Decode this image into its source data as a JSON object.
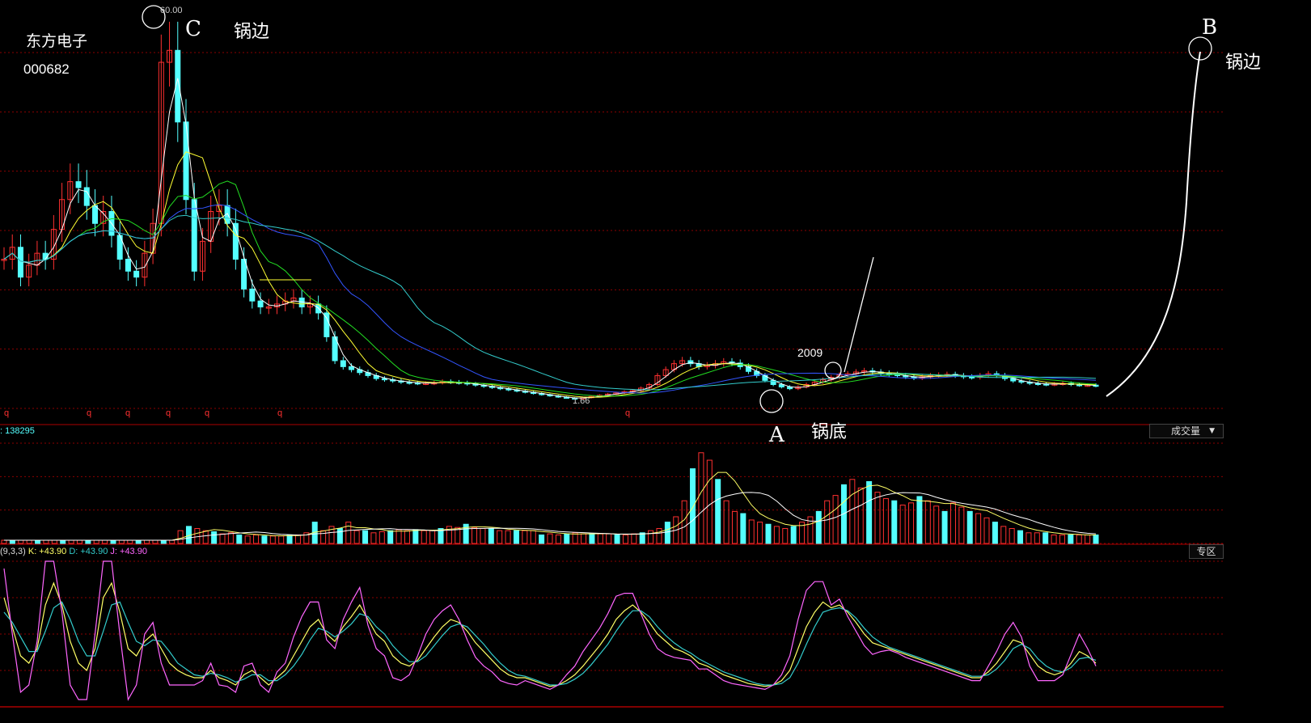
{
  "stock": {
    "name": "东方电子",
    "code": "000682"
  },
  "annotations": {
    "c_letter": "C",
    "c_label": "锅边",
    "b_letter": "B",
    "b_label": "锅边",
    "a_letter": "A",
    "a_label": "锅底",
    "year": "2009",
    "high_price": "60.00",
    "low_price": "1.66"
  },
  "volume_panel": {
    "value_label": ": 138295",
    "dropdown": "成交量"
  },
  "kdj_panel": {
    "params": "(9,3,3)",
    "k_label": "K: +43.90",
    "d_label": "D: +43.90",
    "j_label": "J: +43.90",
    "zone_button": "专区"
  },
  "colors": {
    "up": "#ff3030",
    "down": "#54ffff",
    "grid": "#8b0000",
    "k_line": "#ffff66",
    "d_line": "#33cccc",
    "j_line": "#ff66ff"
  },
  "chart_data": [
    {
      "type": "line",
      "name": "price-panel",
      "x": [
        0,
        10,
        20,
        30,
        40,
        50,
        60,
        70,
        80,
        90,
        100,
        110,
        120,
        130,
        140,
        150,
        160,
        170,
        180,
        190,
        200,
        210,
        220,
        230,
        240,
        250,
        260,
        270,
        280,
        290,
        300,
        310,
        320,
        330,
        340,
        350,
        360,
        370,
        380,
        390,
        400,
        410,
        420,
        430,
        440,
        450,
        460,
        470,
        480,
        490,
        500,
        510,
        520,
        530,
        540,
        550,
        560,
        570,
        580,
        590,
        600,
        610,
        620,
        630,
        640,
        650,
        660,
        670,
        680,
        690,
        700,
        710,
        720,
        730,
        740,
        750,
        760,
        770,
        780,
        790,
        800,
        810,
        820,
        830,
        840,
        850,
        860,
        870,
        880,
        890,
        900,
        910,
        920,
        930,
        940,
        950,
        960,
        970,
        980,
        990,
        1000,
        1010,
        1020,
        1030,
        1040,
        1050,
        1060,
        1070,
        1080,
        1090,
        1100,
        1110,
        1120,
        1130,
        1140,
        1150,
        1160,
        1170,
        1180,
        1190,
        1200,
        1210,
        1220,
        1230,
        1240,
        1250,
        1260,
        1270,
        1280,
        1290,
        1300,
        1310,
        1320
      ],
      "close": [
        25,
        27,
        22,
        24,
        26,
        25,
        30,
        35,
        38,
        37,
        34,
        31,
        33,
        29,
        25,
        23,
        22,
        26,
        31,
        58,
        60,
        48,
        35,
        23,
        28,
        33,
        34,
        31,
        25,
        20,
        18,
        17,
        17,
        17.5,
        18,
        18.5,
        17,
        17.5,
        16,
        12,
        8,
        7,
        6.5,
        6,
        5.5,
        5,
        4.8,
        4.6,
        4.4,
        4.3,
        4.2,
        4.2,
        4.3,
        4.5,
        4.4,
        4.3,
        4.1,
        3.9,
        3.7,
        3.5,
        3.3,
        3.1,
        2.9,
        2.7,
        2.5,
        2.3,
        2.1,
        1.9,
        1.75,
        1.66,
        1.8,
        2,
        2.2,
        2.4,
        2.6,
        2.8,
        3,
        3.4,
        4,
        5.5,
        6.5,
        7.5,
        8,
        7.5,
        7,
        7.2,
        7.5,
        7.8,
        7.6,
        7,
        6.2,
        5.5,
        4.7,
        4,
        3.6,
        3.3,
        3.6,
        4,
        4.4,
        4.8,
        5.2,
        5.6,
        5.8,
        6.1,
        6.3,
        6.1,
        5.9,
        5.7,
        5.5,
        5.3,
        5.1,
        5.3,
        5.5,
        5.6,
        5.7,
        5.5,
        5.3,
        5.2,
        5.5,
        5.8,
        5.5,
        5,
        4.6,
        4.4,
        4.2,
        4.1,
        4,
        4.1,
        4.2,
        4,
        3.9,
        3.9,
        3.8
      ],
      "title": "",
      "xlabel": "",
      "ylabel": "",
      "ylim": [
        0,
        66
      ],
      "grid": true
    },
    {
      "type": "bar",
      "name": "volume-panel",
      "values": [
        3,
        3,
        3,
        3,
        3,
        3,
        3,
        3,
        3,
        3,
        3,
        3,
        3,
        3,
        3,
        3,
        3,
        3,
        3,
        3,
        3,
        12,
        16,
        14,
        12,
        11,
        9,
        10,
        8,
        7,
        8,
        7,
        7,
        7,
        8,
        8,
        10,
        20,
        12,
        16,
        14,
        20,
        12,
        12,
        10,
        11,
        12,
        13,
        12,
        13,
        12,
        12,
        14,
        16,
        15,
        18,
        15,
        14,
        14,
        12,
        12,
        12,
        12,
        12,
        8,
        9,
        8,
        9,
        10,
        9,
        9,
        9,
        9,
        8,
        8,
        9,
        10,
        12,
        14,
        20,
        25,
        40,
        70,
        85,
        78,
        60,
        40,
        30,
        28,
        22,
        20,
        18,
        16,
        14,
        16,
        20,
        25,
        30,
        40,
        45,
        55,
        60,
        52,
        58,
        48,
        42,
        40,
        36,
        38,
        44,
        40,
        35,
        30,
        38,
        34,
        30,
        28,
        24,
        20,
        16,
        14,
        12,
        10,
        10,
        10,
        8,
        8,
        8,
        8,
        8,
        8
      ],
      "ylim": [
        0,
        100
      ],
      "grid": true
    },
    {
      "type": "line",
      "name": "kdj-panel",
      "series": [
        {
          "name": "K",
          "values": [
            75,
            55,
            35,
            30,
            40,
            70,
            85,
            70,
            45,
            30,
            25,
            40,
            75,
            85,
            65,
            40,
            35,
            45,
            50,
            40,
            30,
            25,
            22,
            20,
            20,
            25,
            20,
            18,
            15,
            22,
            25,
            20,
            15,
            20,
            25,
            35,
            45,
            55,
            60,
            50,
            45,
            55,
            62,
            70,
            60,
            50,
            45,
            35,
            30,
            28,
            32,
            40,
            48,
            55,
            60,
            58,
            52,
            44,
            38,
            32,
            26,
            22,
            20,
            20,
            18,
            16,
            14,
            15,
            18,
            22,
            28,
            35,
            42,
            50,
            60,
            66,
            70,
            65,
            58,
            50,
            45,
            40,
            38,
            35,
            30,
            28,
            25,
            22,
            20,
            18,
            16,
            15,
            14,
            15,
            18,
            25,
            40,
            55,
            65,
            72,
            68,
            70,
            65,
            58,
            50,
            44,
            42,
            40,
            38,
            36,
            34,
            32,
            30,
            28,
            26,
            24,
            22,
            20,
            20,
            24,
            30,
            38,
            46,
            44,
            36,
            28,
            24,
            22,
            24,
            30,
            38,
            35,
            30
          ]
        },
        {
          "name": "D",
          "values": [
            65,
            58,
            48,
            38,
            38,
            52,
            68,
            72,
            60,
            45,
            35,
            35,
            52,
            70,
            72,
            58,
            45,
            42,
            46,
            45,
            38,
            30,
            26,
            22,
            21,
            23,
            22,
            20,
            17,
            19,
            22,
            22,
            18,
            18,
            22,
            28,
            36,
            46,
            54,
            52,
            48,
            52,
            57,
            64,
            62,
            55,
            50,
            42,
            36,
            31,
            31,
            35,
            42,
            49,
            55,
            57,
            55,
            49,
            43,
            36,
            30,
            25,
            22,
            21,
            19,
            17,
            15,
            15,
            16,
            19,
            23,
            29,
            36,
            43,
            52,
            60,
            66,
            66,
            62,
            55,
            49,
            44,
            40,
            37,
            33,
            30,
            27,
            24,
            22,
            20,
            18,
            16,
            15,
            15,
            16,
            20,
            30,
            43,
            55,
            65,
            67,
            68,
            66,
            61,
            54,
            48,
            44,
            41,
            39,
            37,
            35,
            33,
            31,
            29,
            27,
            25,
            23,
            21,
            21,
            22,
            26,
            32,
            40,
            43,
            40,
            33,
            28,
            25,
            24,
            27,
            33,
            34,
            32
          ]
        },
        {
          "name": "J",
          "values": [
            95,
            50,
            10,
            15,
            45,
            100,
            100,
            65,
            15,
            5,
            5,
            50,
            100,
            100,
            50,
            5,
            15,
            50,
            58,
            30,
            15,
            15,
            15,
            15,
            18,
            30,
            15,
            14,
            10,
            28,
            30,
            15,
            10,
            24,
            30,
            48,
            62,
            72,
            72,
            46,
            40,
            60,
            72,
            82,
            56,
            40,
            35,
            20,
            18,
            22,
            35,
            50,
            60,
            66,
            70,
            60,
            46,
            34,
            28,
            24,
            18,
            16,
            15,
            18,
            16,
            14,
            12,
            15,
            22,
            28,
            38,
            46,
            54,
            64,
            76,
            78,
            78,
            64,
            50,
            40,
            36,
            34,
            33,
            32,
            26,
            26,
            22,
            18,
            16,
            15,
            14,
            13,
            12,
            15,
            22,
            35,
            60,
            80,
            86,
            86,
            70,
            74,
            62,
            52,
            42,
            36,
            38,
            39,
            37,
            34,
            32,
            30,
            28,
            26,
            24,
            22,
            20,
            18,
            18,
            28,
            38,
            50,
            58,
            48,
            28,
            18,
            18,
            18,
            22,
            36,
            50,
            40,
            28
          ]
        }
      ],
      "ylim": [
        0,
        100
      ],
      "grid": true
    }
  ]
}
